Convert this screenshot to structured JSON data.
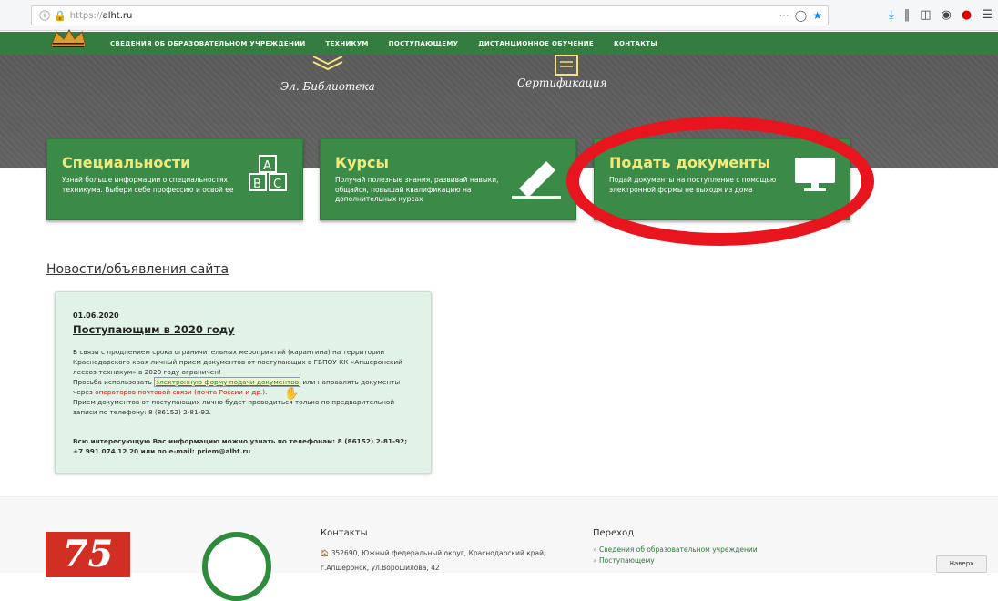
{
  "browser": {
    "url_scheme": "https://",
    "url_host": "alht.ru",
    "info_icon": "info-icon",
    "lock_icon": "lock-icon",
    "more_icon": "···",
    "pocket_icon": "pocket-icon",
    "bookmark_icon": "star-icon"
  },
  "nav": {
    "items": [
      "СВЕДЕНИЯ ОБ ОБРАЗОВАТЕЛЬНОМ УЧРЕЖДЕНИИ",
      "ТЕХНИКУМ",
      "ПОСТУПАЮЩЕМУ",
      "ДИСТАНЦИОННОЕ ОБУЧЕНИЕ",
      "КОНТАКТЫ"
    ]
  },
  "hero": {
    "library_label": "Эл. Библиотека",
    "cert_label": "Сертификация"
  },
  "cards": [
    {
      "title": "Специальности",
      "desc": "Узнай больше информации о специальностях техникума. Выбери себе профессию и освой ее"
    },
    {
      "title": "Курсы",
      "desc": "Получай полезные знания, развивай навыки, общайся, повышай квалификацию на дополнительных курсах"
    },
    {
      "title": "Подать документы",
      "desc": "Подай документы на поступление с помощью электронной формы не выходя из дома"
    }
  ],
  "news": {
    "heading": "Новости/объявления сайта",
    "date": "01.06.2020",
    "title": "Поступающим в 2020 году",
    "body_1": "В связи с продлением срока ограничительных мероприятий (карантина) на территории Краснодарского края личный прием документов от поступающих в ГБПОУ КК «Апшеронский лесхоз-техникум» в 2020 году ограничен!",
    "body_2a": "Просьба использовать ",
    "body_2_link": "электронную форму подачи документов",
    "body_2b": " или направлять документы через ",
    "body_2_red": "операторов почтовой связи (почта России и др.)",
    "body_2c": ".",
    "body_3": "Прием документов от поступающих лично будет проводиться только по предварительной записи по телефону: 8 (86152) 2-81-92.",
    "footer": "Всю интересующую Вас информацию можно узнать по телефонам: 8 (86152) 2-81-92; +7 991 074 12 20 или по e-mail: priem@alht.ru"
  },
  "footer": {
    "logo_text": "75",
    "contacts_heading": "Контакты",
    "address": "352690, Южный федеральный округ, Краснодарский край, г.Апшеронск, ул.Ворошилова, 42",
    "nav_heading": "Переход",
    "nav_items": [
      "Сведения об образовательном учреждении",
      "Поступающему"
    ],
    "to_top": "Наверх"
  }
}
